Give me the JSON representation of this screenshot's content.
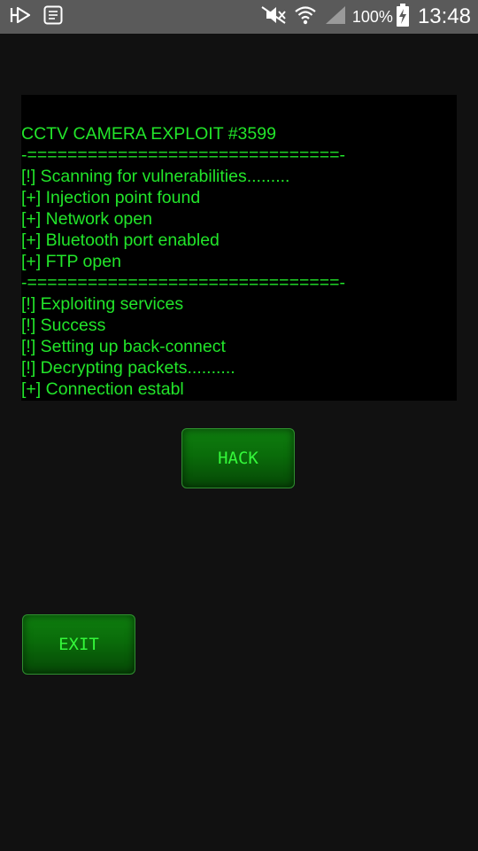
{
  "status_bar": {
    "battery_percent": "100%",
    "time": "13:48",
    "icons": [
      "notification-arrow-icon",
      "screenshot-icon",
      "mute-icon",
      "wifi-icon",
      "signal-icon",
      "battery-charging-icon"
    ]
  },
  "console": {
    "title": "CCTV CAMERA EXPLOIT #3599",
    "lines": [
      "CCTV CAMERA EXPLOIT #3599",
      "-===============================-",
      "[!] Scanning for vulnerabilities.........",
      "[+] Injection point found",
      "[+] Network open",
      "[+] Bluetooth port enabled",
      "[+] FTP open",
      "-===============================-",
      "[!] Exploiting services",
      "[!] Success",
      "[!] Setting up back-connect",
      "[!] Decrypting packets..........",
      "[+] Connection establ"
    ]
  },
  "buttons": {
    "hack_label": "HACK",
    "exit_label": "EXIT"
  },
  "colors": {
    "terminal_green": "#22e52a",
    "button_green": "#0a6c0a",
    "background": "#111111",
    "console_bg": "#000000",
    "status_bar": "#5a5a5a"
  }
}
